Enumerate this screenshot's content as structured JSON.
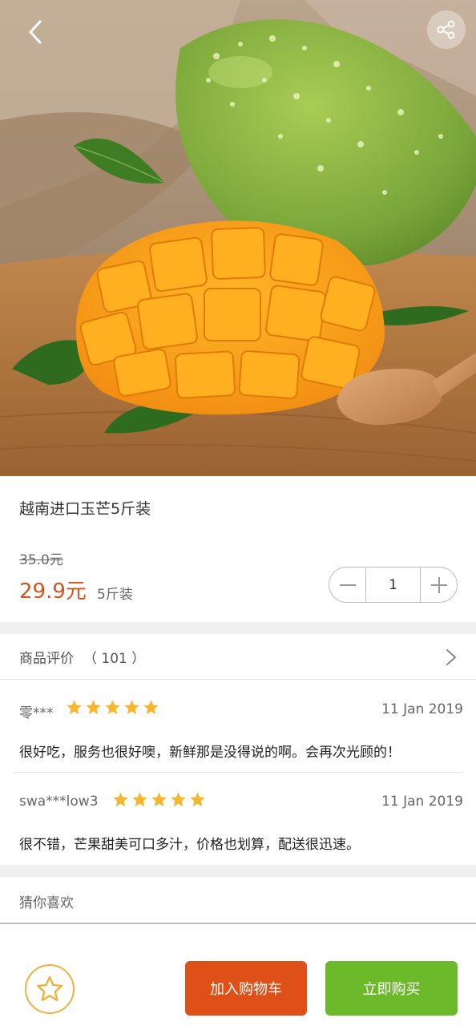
{
  "product": {
    "title": "越南进口玉芒5斤装",
    "original_price": "35.0元",
    "price": "29.9元",
    "spec": "5斤装",
    "quantity": "1",
    "image_desc": "mango-product-photo"
  },
  "reviews": {
    "label": "商品评价",
    "count": "（ 101 ）",
    "items": [
      {
        "user": "零***",
        "rating": 5,
        "date": "11 Jan 2019",
        "text": "很好吃，服务也很好噢，新鲜那是没得说的啊。会再次光顾的！"
      },
      {
        "user": "swa***low3",
        "rating": 5,
        "date": "11 Jan 2019",
        "text": "很不错，芒果甜美可口多汁，价格也划算，配送很迅速。"
      }
    ]
  },
  "recommend": {
    "label": "猜你喜欢"
  },
  "actions": {
    "add_to_cart": "加入购物车",
    "buy_now": "立即购买"
  },
  "icons": {
    "back": "chevron-left-icon",
    "share": "share-icon",
    "minus": "minus-icon",
    "plus": "plus-icon",
    "chevron": "chevron-right-icon",
    "favorite": "star-outline-icon"
  },
  "colors": {
    "price": "#d9531e",
    "star": "#f6b62d",
    "cart_button": "#de5017",
    "buy_button": "#6cba2a",
    "favorite_border": "#f0b13c"
  }
}
